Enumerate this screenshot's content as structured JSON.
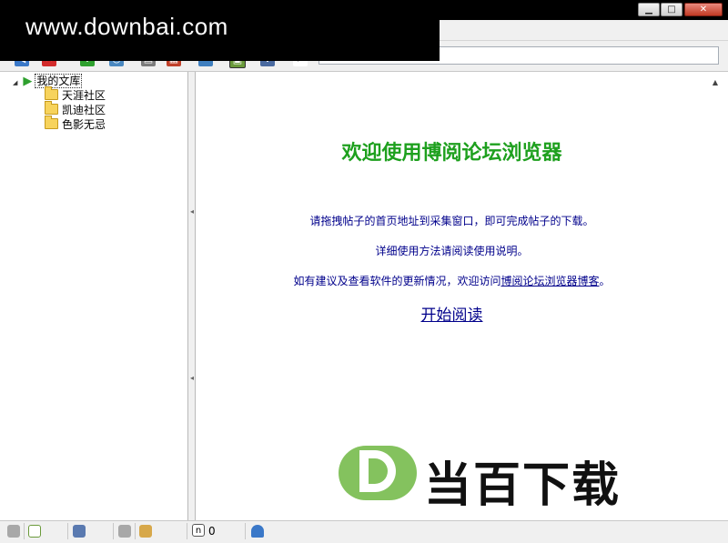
{
  "watermark": {
    "site": "www.downbai.com"
  },
  "window": {
    "controls": {
      "minimize": "▁",
      "maximize": "□",
      "close": "✕"
    }
  },
  "address": {
    "value": ""
  },
  "toolbar": {
    "icons": [
      "back-icon",
      "delete-icon",
      "download-icon",
      "settings-icon",
      "copy-icon",
      "paste-icon",
      "export-icon",
      "view-icon",
      "tools-icon",
      "search-icon"
    ]
  },
  "tree": {
    "root": "我的文库",
    "items": [
      {
        "label": "天涯社区"
      },
      {
        "label": "凯迪社区"
      },
      {
        "label": "色影无忌"
      }
    ]
  },
  "welcome": {
    "title": "欢迎使用博阅论坛浏览器",
    "line1": "请拖拽帖子的首页地址到采集窗口，即可完成帖子的下载。",
    "line2": "详细使用方法请阅读使用说明。",
    "line3_prefix": "如有建议及查看软件的更新情况，欢迎访问",
    "line3_link": "博阅论坛浏览器博客",
    "line3_suffix": "。",
    "start_link": "开始阅读"
  },
  "logo": {
    "text": "当百下载",
    "letter": "D"
  },
  "status": {
    "count": "0",
    "n_label": "n"
  },
  "colors": {
    "title_green": "#1ea01e",
    "info_blue": "#00008b",
    "logo_green": "#84c25e"
  }
}
